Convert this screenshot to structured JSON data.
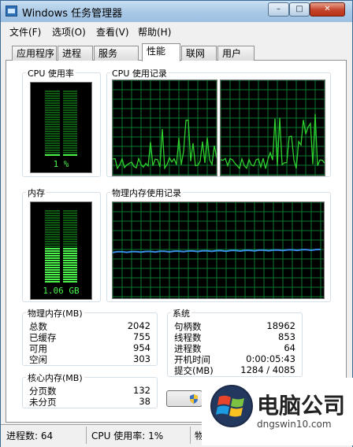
{
  "window": {
    "title": "Windows 任务管理器",
    "min_label": "–",
    "max_label": "□",
    "close_label": "✕"
  },
  "menu": [
    {
      "label": "文件(F)"
    },
    {
      "label": "选项(O)"
    },
    {
      "label": "查看(V)"
    },
    {
      "label": "帮助(H)"
    }
  ],
  "tabs": [
    {
      "label": "应用程序"
    },
    {
      "label": "进程"
    },
    {
      "label": "服务"
    },
    {
      "label": "性能"
    },
    {
      "label": "联网"
    },
    {
      "label": "用户"
    }
  ],
  "active_tab": "性能",
  "cpu": {
    "title": "CPU 使用率",
    "value": "1 %",
    "history_title": "CPU 使用记录"
  },
  "memory": {
    "title": "内存",
    "value": "1.06 GB",
    "fill_fraction": 0.49,
    "history_title": "物理内存使用记录"
  },
  "physical_memory": {
    "title": "物理内存(MB)",
    "rows": [
      {
        "label": "总数",
        "value": "2042"
      },
      {
        "label": "已缓存",
        "value": "755"
      },
      {
        "label": "可用",
        "value": "954"
      },
      {
        "label": "空闲",
        "value": "303"
      }
    ]
  },
  "kernel_memory": {
    "title": "核心内存(MB)",
    "rows": [
      {
        "label": "分页数",
        "value": "132"
      },
      {
        "label": "未分页",
        "value": "38"
      }
    ]
  },
  "system": {
    "title": "系统",
    "rows": [
      {
        "label": "句柄数",
        "value": "18962"
      },
      {
        "label": "线程数",
        "value": "853"
      },
      {
        "label": "进程数",
        "value": "64"
      },
      {
        "label": "开机时间",
        "value": "0:00:05:43"
      },
      {
        "label": "提交(MB)",
        "value": "1284 / 4085"
      }
    ]
  },
  "status": {
    "processes": "进程数: 64",
    "cpu_usage": "CPU 使用率: 1%",
    "memory_partial": "物"
  },
  "watermark": {
    "text": "电脑公司",
    "url": "dngswin10.com"
  },
  "colors": {
    "graph_line": "#2fd12f",
    "grid": "#087a2f",
    "memory_line": "#3a8ee6",
    "meter_on": "#4af64a",
    "meter_off": "#0f5a12"
  }
}
